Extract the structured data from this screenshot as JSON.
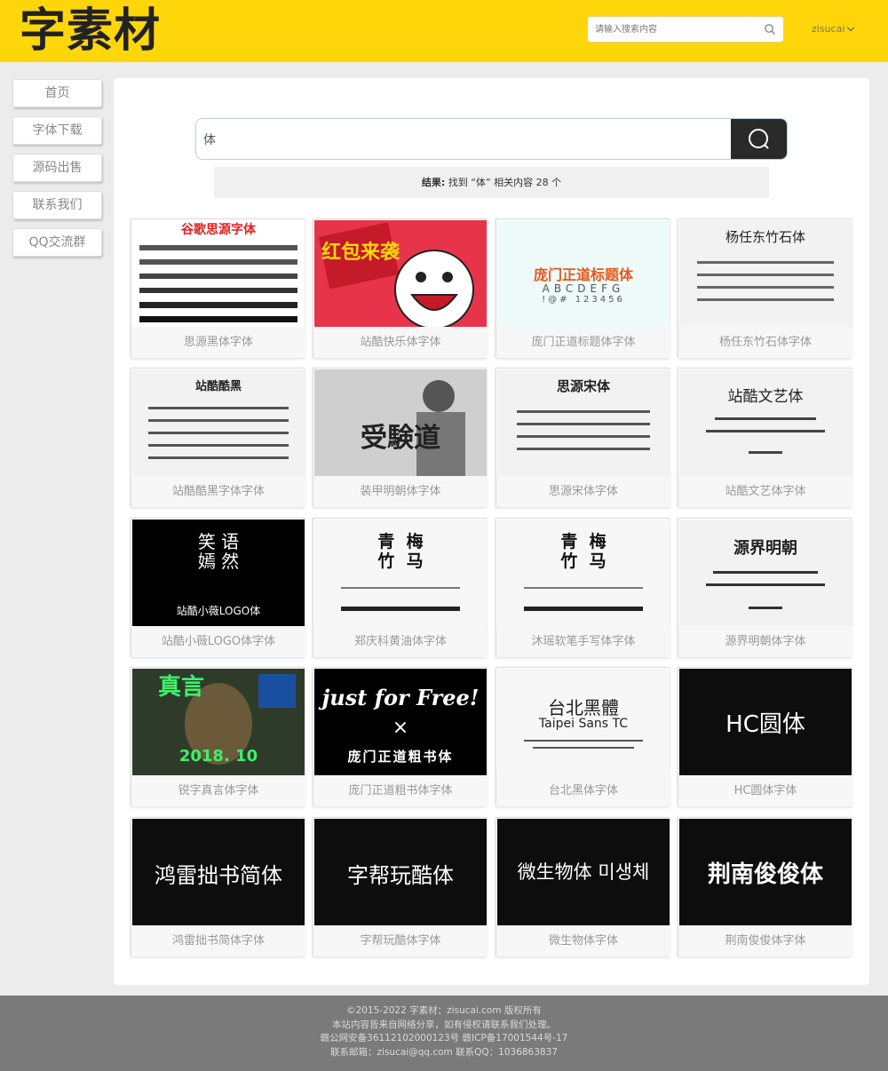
{
  "header": {
    "logo": "字素材",
    "search_placeholder": "请输入搜索内容",
    "user": "zisucai"
  },
  "sidebar": {
    "items": [
      {
        "label": "首页"
      },
      {
        "label": "字体下载"
      },
      {
        "label": "源码出售"
      },
      {
        "label": "联系我们"
      },
      {
        "label": "QQ交流群"
      }
    ]
  },
  "search": {
    "value": "体",
    "result_prefix": "结果:",
    "result_text": "找到 “体” 相关内容 28 个"
  },
  "cards": [
    {
      "title": "思源黑体字体",
      "art": "谷歌思源字体"
    },
    {
      "title": "站酷快乐体字体",
      "art": "红包来袭"
    },
    {
      "title": "庞门正道标题体字体",
      "art": "庞门正道标题体",
      "art2": "ABCDEFG",
      "art3": "!@#  123456"
    },
    {
      "title": "杨任东竹石体字体",
      "art": "杨任东竹石体"
    },
    {
      "title": "站酷酷黑字体字体",
      "art": "站酷酷黑"
    },
    {
      "title": "装甲明朝体字体",
      "art": "受験道"
    },
    {
      "title": "思源宋体字体",
      "art": "思源宋体"
    },
    {
      "title": "站酷文艺体字体",
      "art": "站酷文艺体"
    },
    {
      "title": "站酷小薇LOGO体字体",
      "art": "笑 语\n嫣 然",
      "art2": "站酷小薇LOGO体"
    },
    {
      "title": "郑庆科黄油体字体",
      "art": "青  梅\n竹  马"
    },
    {
      "title": "沐瑶软笔手写体字体",
      "art": "青  梅\n竹  马"
    },
    {
      "title": "源界明朝体字体",
      "art": "源界明朝"
    },
    {
      "title": "锐字真言体字体",
      "art": "真言",
      "art2": "2018. 10"
    },
    {
      "title": "庞门正道粗书体字体",
      "art": "just for Free!",
      "art2": "庞门正道粗书体"
    },
    {
      "title": "台北黑体字体",
      "art": "台北黑體",
      "art2": "Taipei Sans TC"
    },
    {
      "title": "HC圆体字体",
      "art": "HC圆体"
    },
    {
      "title": "鸿雷拙书简体字体",
      "art": "鸿雷拙书简体"
    },
    {
      "title": "字帮玩酷体字体",
      "art": "字帮玩酷体"
    },
    {
      "title": "微生物体字体",
      "art": "微生物体 미생체"
    },
    {
      "title": "荆南俊俊体字体",
      "art": "荆南俊俊体"
    }
  ],
  "footer": {
    "lines": [
      "©2015-2022 字素材：zisucai.com 版权所有",
      "本站内容皆来自网络分享，如有侵权请联系我们处理。",
      "赣公网安备36112102000123号 赣ICP备17001544号-17",
      "联系邮箱：zisucai@qq.com 联系QQ：1036863837"
    ]
  },
  "colors": {
    "brand": "#ffd60a",
    "dark_button": "#2a2a2a",
    "footer": "#7a7a7a"
  }
}
